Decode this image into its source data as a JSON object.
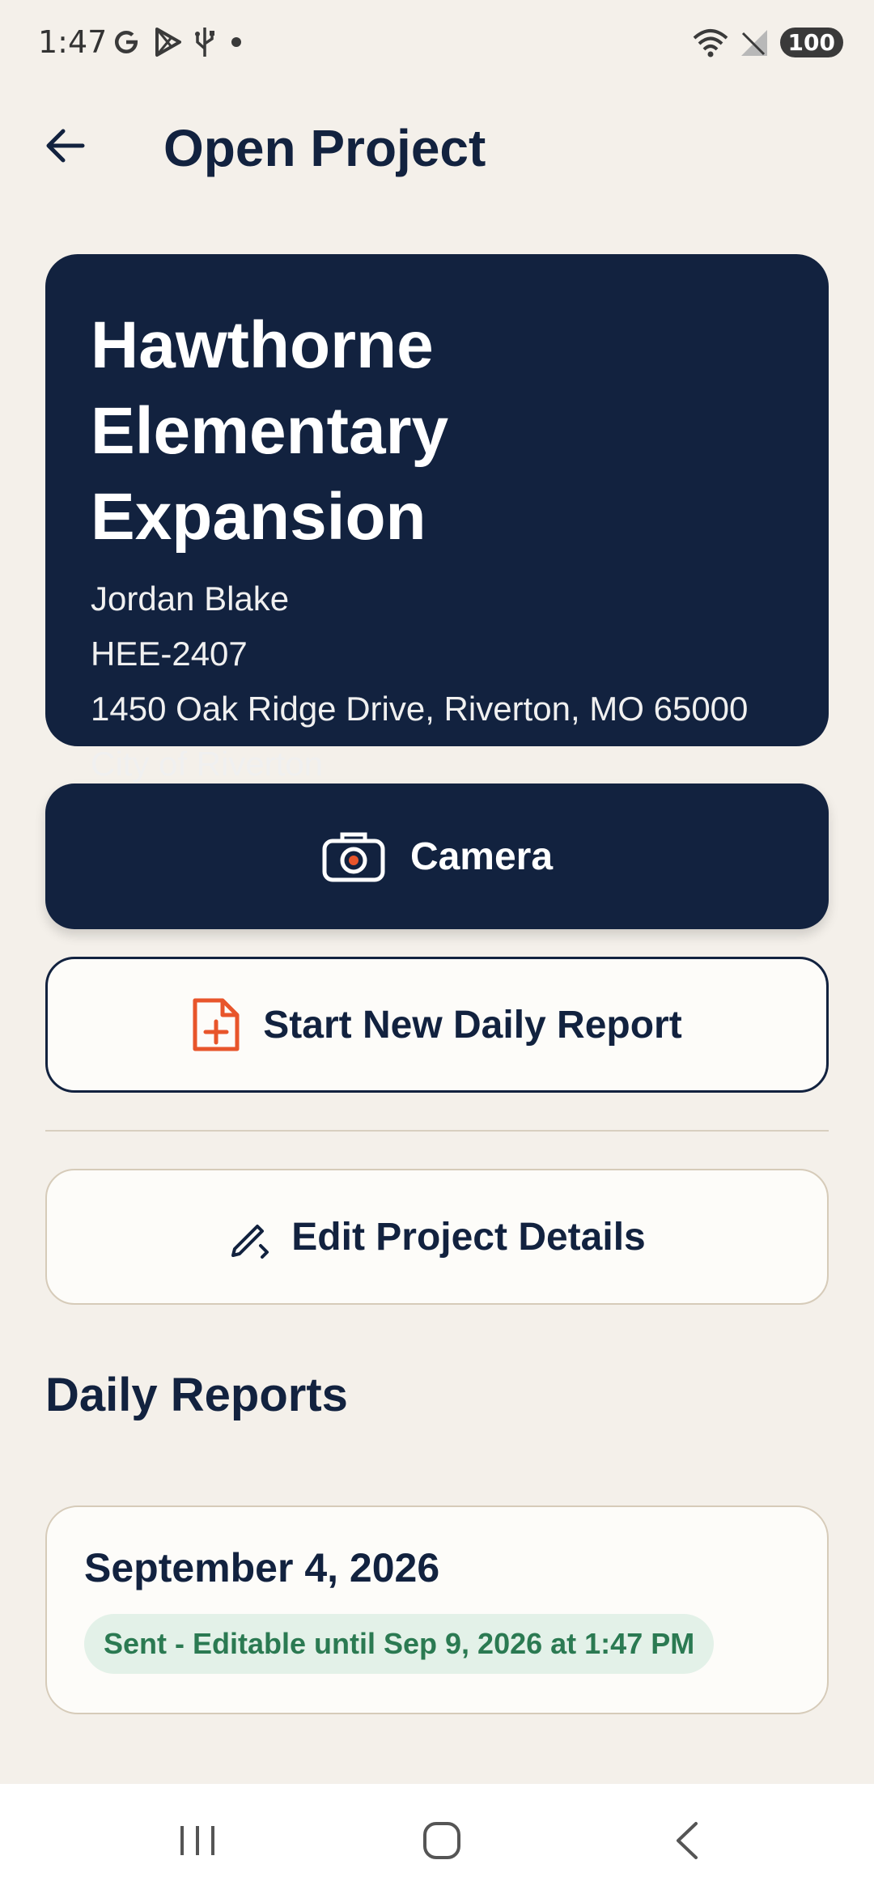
{
  "status_bar": {
    "time": "1:47",
    "battery": "100",
    "left_icons": [
      "google-icon",
      "play-store-icon",
      "usb-icon",
      "dot-icon"
    ],
    "right_icons": [
      "wifi-icon",
      "signal-icon",
      "battery-icon"
    ]
  },
  "app_bar": {
    "title": "Open Project",
    "back_icon": "back-arrow-icon"
  },
  "project": {
    "name": "Hawthorne Elementary Expansion",
    "manager": "Jordan Blake",
    "code": "HEE-2407",
    "address": "1450 Oak Ridge Drive, Riverton, MO 65000",
    "client": "City of Riverton"
  },
  "actions": {
    "camera_label": "Camera",
    "new_report_label": "Start New Daily Report",
    "edit_label": "Edit Project Details"
  },
  "daily_reports": {
    "title": "Daily Reports",
    "items": [
      {
        "date": "September 4, 2026",
        "status": "Sent - Editable until Sep 9, 2026 at 1:47 PM"
      }
    ]
  },
  "colors": {
    "primary": "#12223f",
    "accent": "#e8552b",
    "background": "#f4f0ea",
    "status_green": "#2b7a52",
    "status_green_bg": "#e3f1e8"
  }
}
